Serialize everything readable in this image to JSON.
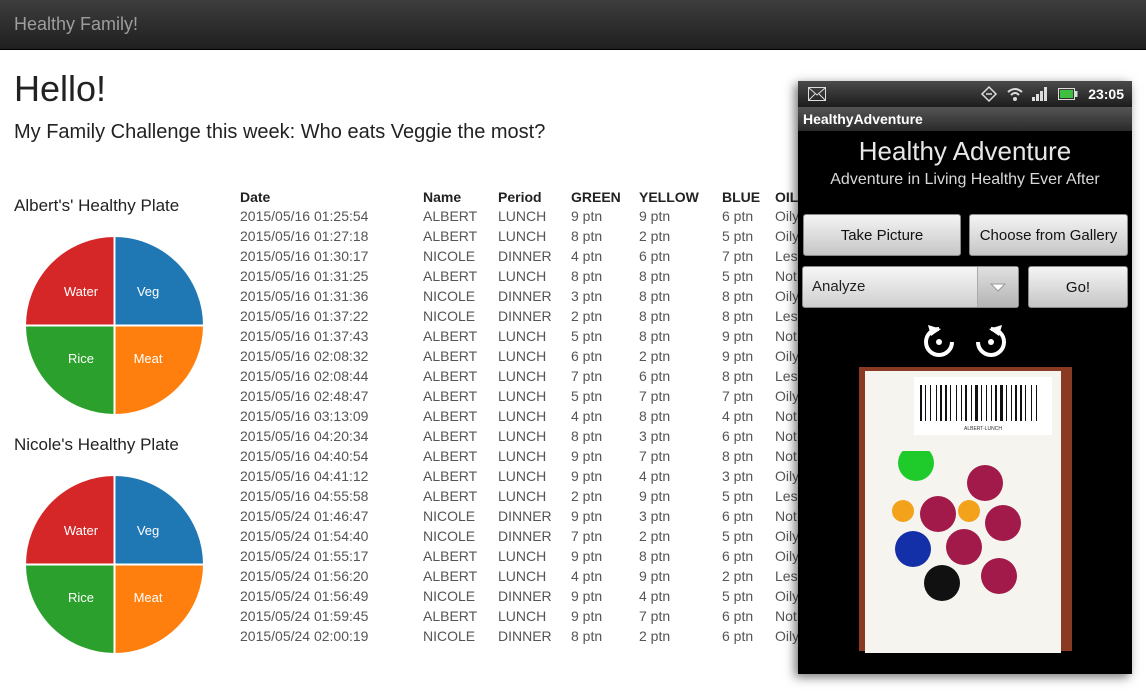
{
  "brand": "Healthy Family!",
  "greeting": "Hello!",
  "challenge": "My Family Challenge this week: Who eats Veggie the most?",
  "plates": [
    {
      "title": "Albert's' Healthy Plate",
      "slices": [
        {
          "label": "Water",
          "value": 25,
          "color": "#d62728"
        },
        {
          "label": "Veg",
          "value": 25,
          "color": "#1f77b4"
        },
        {
          "label": "Rice",
          "value": 25,
          "color": "#2ca02c"
        },
        {
          "label": "Meat",
          "value": 25,
          "color": "#ff7f0e"
        }
      ]
    },
    {
      "title": "Nicole's Healthy Plate",
      "slices": [
        {
          "label": "Water",
          "value": 25,
          "color": "#d62728"
        },
        {
          "label": "Veg",
          "value": 25,
          "color": "#1f77b4"
        },
        {
          "label": "Rice",
          "value": 25,
          "color": "#2ca02c"
        },
        {
          "label": "Meat",
          "value": 25,
          "color": "#ff7f0e"
        }
      ]
    }
  ],
  "table": {
    "headers": [
      "Date",
      "Name",
      "Period",
      "GREEN",
      "YELLOW",
      "BLUE",
      "OIL"
    ],
    "rows": [
      [
        "2015/05/16 01:25:54",
        "ALBERT",
        "LUNCH",
        "9 ptn",
        "9 ptn",
        "6 ptn",
        "Oily"
      ],
      [
        "2015/05/16 01:27:18",
        "ALBERT",
        "LUNCH",
        "8 ptn",
        "2 ptn",
        "5 ptn",
        "Oily"
      ],
      [
        "2015/05/16 01:30:17",
        "NICOLE",
        "DINNER",
        "4 ptn",
        "6 ptn",
        "7 ptn",
        "Les"
      ],
      [
        "2015/05/16 01:31:25",
        "ALBERT",
        "LUNCH",
        "8 ptn",
        "8 ptn",
        "5 ptn",
        "Not"
      ],
      [
        "2015/05/16 01:31:36",
        "NICOLE",
        "DINNER",
        "3 ptn",
        "8 ptn",
        "8 ptn",
        "Oily"
      ],
      [
        "2015/05/16 01:37:22",
        "NICOLE",
        "DINNER",
        "2 ptn",
        "8 ptn",
        "8 ptn",
        "Les"
      ],
      [
        "2015/05/16 01:37:43",
        "ALBERT",
        "LUNCH",
        "5 ptn",
        "8 ptn",
        "9 ptn",
        "Not"
      ],
      [
        "2015/05/16 02:08:32",
        "ALBERT",
        "LUNCH",
        "6 ptn",
        "2 ptn",
        "9 ptn",
        "Oily"
      ],
      [
        "2015/05/16 02:08:44",
        "ALBERT",
        "LUNCH",
        "7 ptn",
        "6 ptn",
        "8 ptn",
        "Les"
      ],
      [
        "2015/05/16 02:48:47",
        "ALBERT",
        "LUNCH",
        "5 ptn",
        "7 ptn",
        "7 ptn",
        "Oily"
      ],
      [
        "2015/05/16 03:13:09",
        "ALBERT",
        "LUNCH",
        "4 ptn",
        "8 ptn",
        "4 ptn",
        "Not"
      ],
      [
        "2015/05/16 04:20:34",
        "ALBERT",
        "LUNCH",
        "8 ptn",
        "3 ptn",
        "6 ptn",
        "Not"
      ],
      [
        "2015/05/16 04:40:54",
        "ALBERT",
        "LUNCH",
        "9 ptn",
        "7 ptn",
        "8 ptn",
        "Not"
      ],
      [
        "2015/05/16 04:41:12",
        "ALBERT",
        "LUNCH",
        "9 ptn",
        "4 ptn",
        "3 ptn",
        "Oily"
      ],
      [
        "2015/05/16 04:55:58",
        "ALBERT",
        "LUNCH",
        "2 ptn",
        "9 ptn",
        "5 ptn",
        "Les"
      ],
      [
        "2015/05/24 01:46:47",
        "NICOLE",
        "DINNER",
        "9 ptn",
        "3 ptn",
        "6 ptn",
        "Not"
      ],
      [
        "2015/05/24 01:54:40",
        "NICOLE",
        "DINNER",
        "7 ptn",
        "2 ptn",
        "5 ptn",
        "Oily"
      ],
      [
        "2015/05/24 01:55:17",
        "ALBERT",
        "LUNCH",
        "9 ptn",
        "8 ptn",
        "6 ptn",
        "Oily"
      ],
      [
        "2015/05/24 01:56:20",
        "ALBERT",
        "LUNCH",
        "4 ptn",
        "9 ptn",
        "2 ptn",
        "Les"
      ],
      [
        "2015/05/24 01:56:49",
        "NICOLE",
        "DINNER",
        "9 ptn",
        "4 ptn",
        "5 ptn",
        "Oily"
      ],
      [
        "2015/05/24 01:59:45",
        "ALBERT",
        "LUNCH",
        "9 ptn",
        "7 ptn",
        "6 ptn",
        "Not"
      ],
      [
        "2015/05/24 02:00:19",
        "NICOLE",
        "DINNER",
        "8 ptn",
        "2 ptn",
        "6 ptn",
        "Oily"
      ]
    ]
  },
  "phone": {
    "clock": "23:05",
    "icons": [
      "mail-icon",
      "sync-icon",
      "wifi-icon",
      "signal-icon",
      "battery-icon"
    ],
    "app_title": "HealthyAdventure",
    "heading": "Healthy Adventure",
    "subheading": "Adventure in Living Healthy Ever After",
    "take_picture": "Take Picture",
    "choose_gallery": "Choose from Gallery",
    "mode_selected": "Analyze",
    "go": "Go!",
    "photo_label": "ALBERT-LUNCH",
    "dot_colors": {
      "green": "#1ecb2b",
      "yellow": "#f2a31b",
      "blue": "#1430a8",
      "red": "#a11a4a",
      "black": "#111111"
    }
  },
  "chart_data": [
    {
      "type": "pie",
      "title": "Albert's' Healthy Plate",
      "categories": [
        "Water",
        "Veg",
        "Rice",
        "Meat"
      ],
      "values": [
        25,
        25,
        25,
        25
      ]
    },
    {
      "type": "pie",
      "title": "Nicole's Healthy Plate",
      "categories": [
        "Water",
        "Veg",
        "Rice",
        "Meat"
      ],
      "values": [
        25,
        25,
        25,
        25
      ]
    }
  ]
}
